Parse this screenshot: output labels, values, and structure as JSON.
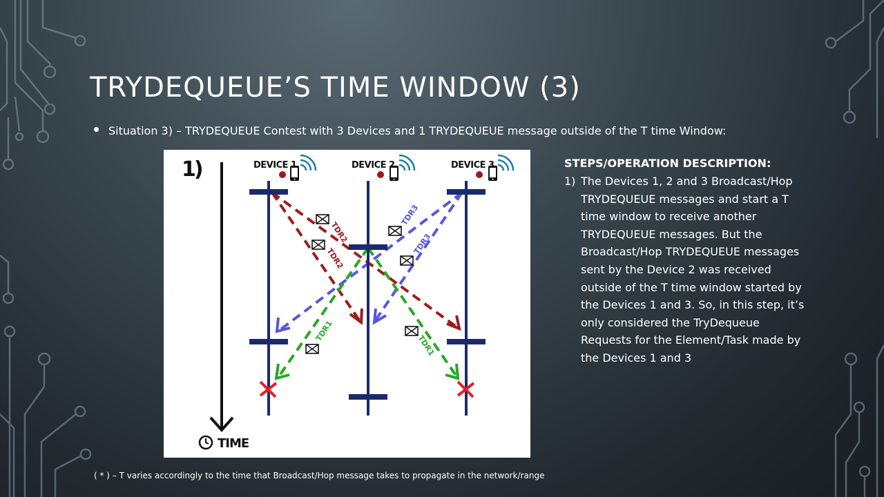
{
  "slide": {
    "title": "TRYDEQUEUE’S TIME WINDOW (3)",
    "bullet": "Situation 3) – TRYDEQUEUE Contest with 3 Devices and 1 TRYDEQUEUE message outside of the T time Window:",
    "footnote": "( * ) – T varies accordingly to the time that Broadcast/Hop message takes to propagate in the network/range"
  },
  "diagram": {
    "step_number": "1)",
    "devices": [
      "DEVICE 1",
      "DEVICE 2",
      "DEVICE 3"
    ],
    "time_label": "TIME",
    "message_labels": {
      "tdr2_a": "TDR2",
      "tdr2_b": "TDR2",
      "tdr3_a": "TDR3",
      "tdr3_b": "TDR3",
      "tdr1_a": "TDR1",
      "tdr1_b": "TDR1"
    },
    "colors": {
      "device_line": "#1a2a6c",
      "tdr2": "#a01a1a",
      "tdr3": "#5656e0",
      "tdr1": "#27a827",
      "reject": "#e0202a",
      "wifi": "#1e7fa0"
    }
  },
  "steps": {
    "heading": "STEPS/OPERATION DESCRIPTION:",
    "items": [
      {
        "number": "1)",
        "text": "The Devices 1, 2 and 3 Broadcast/Hop TRYDEQUEUE messages and start a T time window to receive another TRYDEQUEUE messages. But the Broadcast/Hop TRYDEQUEUE messages sent by the Device 2 was received outside of the T time window started by the Devices 1 and 3. So, in this step, it’s only considered the TryDequeue Requests for the Element/Task made by the Devices 1 and 3"
      }
    ]
  }
}
